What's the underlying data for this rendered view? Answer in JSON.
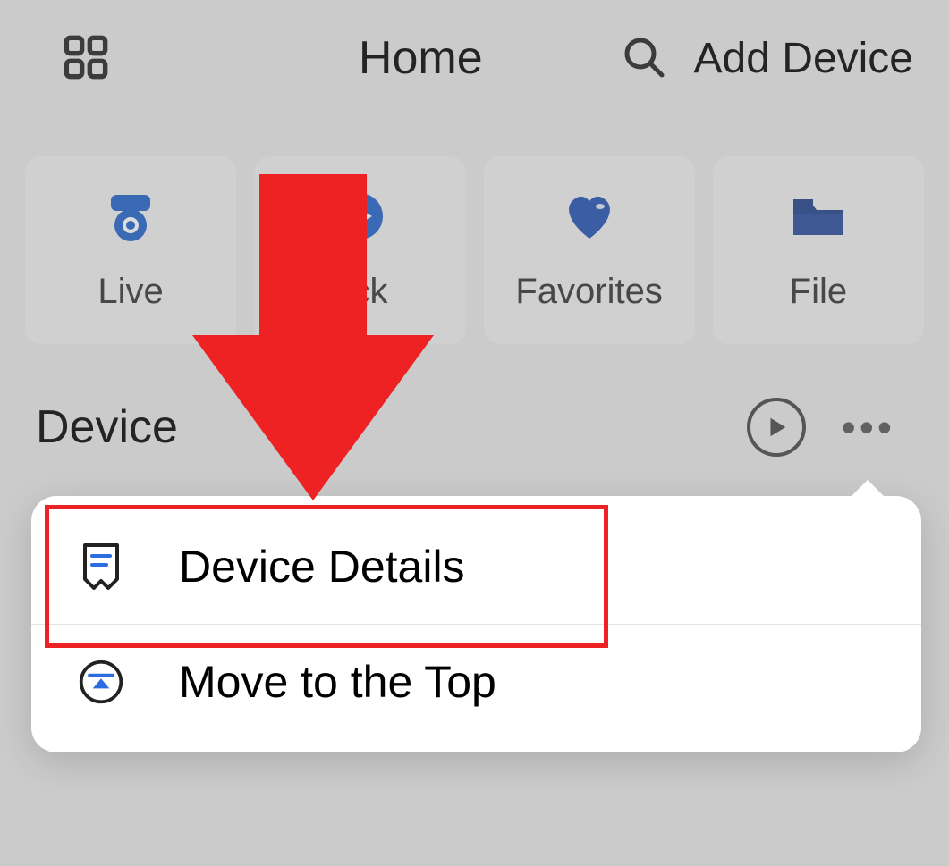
{
  "header": {
    "title": "Home",
    "add_device": "Add Device"
  },
  "cards": [
    {
      "label": "Live"
    },
    {
      "label": "ack"
    },
    {
      "label": "Favorites"
    },
    {
      "label": "File"
    }
  ],
  "section": {
    "title": "Device"
  },
  "popup": {
    "items": [
      {
        "label": "Device Details"
      },
      {
        "label": "Move to the Top"
      }
    ]
  }
}
